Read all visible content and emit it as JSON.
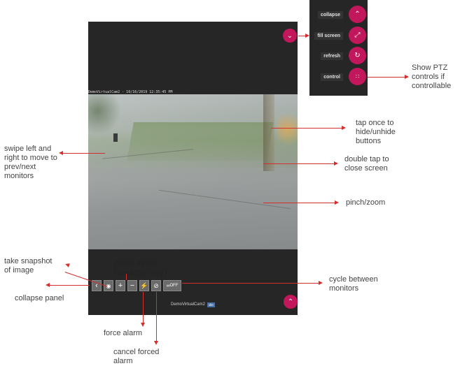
{
  "screen": {
    "timestamp": "DemoVirtualCam2 - 10/16/2019 12:35:45 PM",
    "monitor_name": "DemoVirtualCam2",
    "monitor_tag": "idle",
    "cycle_label": "OFF"
  },
  "ptz_menu": {
    "items": [
      {
        "label": "collapse",
        "icon": "chevron-up-icon"
      },
      {
        "label": "fill screen",
        "icon": "expand-icon"
      },
      {
        "label": "refresh",
        "icon": "refresh-icon"
      },
      {
        "label": "control",
        "icon": "ptz-control-icon"
      }
    ]
  },
  "annotations": {
    "show_ptz": [
      "Show PTZ",
      "controls if",
      "controllable"
    ],
    "tap_once": [
      "tap once to",
      "hide/unhide",
      "buttons"
    ],
    "swipe": [
      "swipe left and",
      "right to move to",
      "prev/next",
      "monitors"
    ],
    "double_tap": [
      "double tap to",
      "close screen"
    ],
    "pinch": "pinch/zoom",
    "snapshot": [
      "take snapshot",
      "of image"
    ],
    "zoom": [
      "zoom in/out",
      "(desktop only)"
    ],
    "cycle": [
      "cycle between",
      "monitors"
    ],
    "collapse_panel": "collapse panel",
    "force_alarm": "force alarm",
    "cancel_alarm": [
      "cancel forced",
      "alarm"
    ]
  },
  "colors": {
    "accent": "#c2185b",
    "arrow": "#d32f2f",
    "screen_bg": "#262626"
  }
}
